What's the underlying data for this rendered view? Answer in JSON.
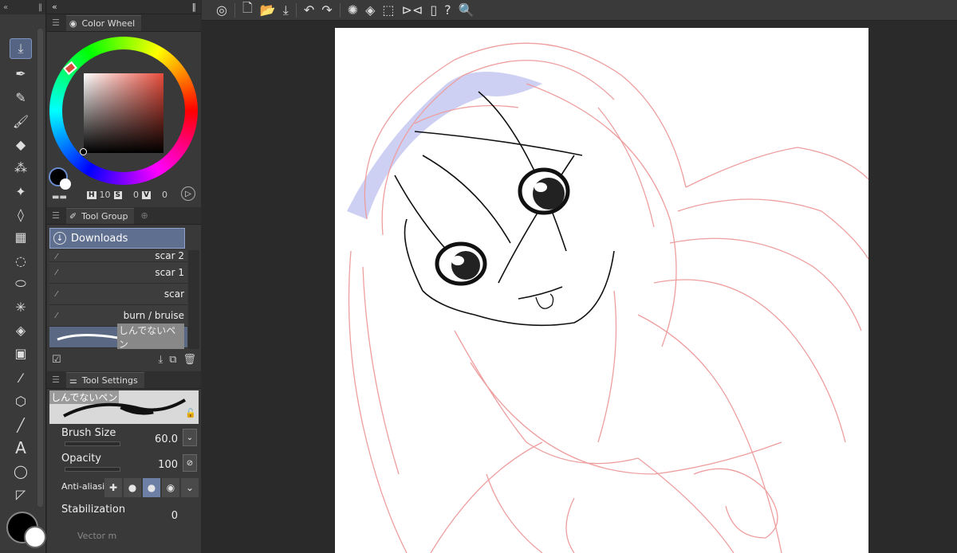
{
  "toolbox": {
    "tools": [
      "download-tool",
      "pen-tool",
      "pencil-tool",
      "brush-tool",
      "eraser-tool",
      "airbrush-tool",
      "decoration-tool",
      "blend-tool",
      "grid-tool",
      "lasso-tool",
      "lasso-fill-tool",
      "sparkle-tool",
      "fill-tool",
      "gradient-tool",
      "eyedropper-tool",
      "3d-tool",
      "line-tool",
      "text-tool",
      "balloon-tool",
      "ruler-tool"
    ]
  },
  "color_wheel": {
    "title": "Color Wheel",
    "h_tag": "H",
    "h_value": "10",
    "s_tag": "S",
    "s_value": "0",
    "v_tag": "V",
    "v_value": "0",
    "main_color": "#000000",
    "sub_color": "#ffffff",
    "hue_color": "#e74c3c"
  },
  "tool_group": {
    "title": "Tool Group",
    "group_name": "Downloads",
    "subtools": [
      {
        "label": "scar 2"
      },
      {
        "label": "scar 1"
      },
      {
        "label": "scar"
      },
      {
        "label": "burn / bruise"
      },
      {
        "label": "しんでないペン"
      }
    ]
  },
  "tool_settings": {
    "title": "Tool Settings",
    "brush_name": "しんでないペン",
    "brush_size_label": "Brush Size",
    "brush_size_value": "60.0",
    "opacity_label": "Opacity",
    "opacity_value": "100",
    "antialias_label": "Anti-aliasin",
    "stabilization_label": "Stabilization",
    "stabilization_value": "0",
    "vector_label": "Vector m"
  },
  "accent_color": "#5f6f8f"
}
